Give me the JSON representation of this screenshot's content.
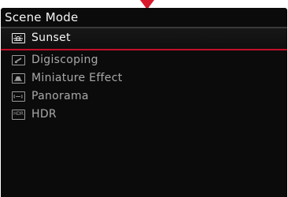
{
  "screen": {
    "title": "Scene Mode",
    "accent_color": "#d8192c",
    "items": [
      {
        "label": "Sunset",
        "icon": "sunset-icon",
        "selected": true
      },
      {
        "label": "Digiscoping",
        "icon": "digiscoping-icon",
        "selected": false
      },
      {
        "label": "Miniature Effect",
        "icon": "miniature-effect-icon",
        "selected": false
      },
      {
        "label": "Panorama",
        "icon": "panorama-icon",
        "selected": false
      },
      {
        "label": "HDR",
        "icon": "hdr-icon",
        "icon_text": "HDR",
        "selected": false
      }
    ]
  }
}
